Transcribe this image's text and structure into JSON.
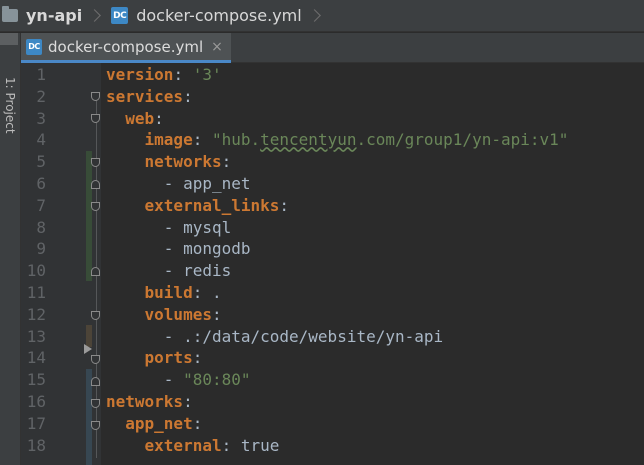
{
  "breadcrumb": {
    "project": "yn-api",
    "file": "docker-compose.yml",
    "file_icon": "DC"
  },
  "toolstrip": {
    "label": "1: Project"
  },
  "tab": {
    "label": "docker-compose.yml",
    "close": "×",
    "icon": "DC"
  },
  "editor": {
    "lines": [
      {
        "n": "1",
        "key": "version",
        "sep": ": ",
        "value": "'3'",
        "vtype": "str"
      },
      {
        "n": "2",
        "key": "services",
        "sep": ":",
        "value": "",
        "vtype": ""
      },
      {
        "n": "3",
        "indent": "  ",
        "key": "web",
        "sep": ":",
        "value": "",
        "vtype": ""
      },
      {
        "n": "4",
        "indent": "    ",
        "key": "image",
        "sep": ": ",
        "value": "\"hub.tencentyun.com/group1/yn-api:v1\"",
        "vtype": "str"
      },
      {
        "n": "5",
        "indent": "    ",
        "key": "networks",
        "sep": ":",
        "value": "",
        "vtype": ""
      },
      {
        "n": "6",
        "indent": "      ",
        "key": "",
        "sep": "",
        "value": "- app_net",
        "vtype": "plain"
      },
      {
        "n": "7",
        "indent": "    ",
        "key": "external_links",
        "sep": ":",
        "value": "",
        "vtype": ""
      },
      {
        "n": "8",
        "indent": "      ",
        "key": "",
        "sep": "",
        "value": "- mysql",
        "vtype": "plain"
      },
      {
        "n": "9",
        "indent": "      ",
        "key": "",
        "sep": "",
        "value": "- mongodb",
        "vtype": "plain"
      },
      {
        "n": "10",
        "indent": "      ",
        "key": "",
        "sep": "",
        "value": "- redis",
        "vtype": "plain"
      },
      {
        "n": "11",
        "indent": "    ",
        "key": "build",
        "sep": ": ",
        "value": ".",
        "vtype": "plain"
      },
      {
        "n": "12",
        "indent": "    ",
        "key": "volumes",
        "sep": ":",
        "value": "",
        "vtype": ""
      },
      {
        "n": "13",
        "indent": "      ",
        "key": "",
        "sep": "",
        "value": "- .:/data/code/website/yn-api",
        "vtype": "plain"
      },
      {
        "n": "14",
        "indent": "    ",
        "key": "ports",
        "sep": ":",
        "value": "",
        "vtype": ""
      },
      {
        "n": "15",
        "indent": "      ",
        "key": "",
        "sep": "",
        "value": "- \"80:80\"",
        "vtype": "mixed"
      },
      {
        "n": "16",
        "key": "networks",
        "sep": ":",
        "value": "",
        "vtype": ""
      },
      {
        "n": "17",
        "indent": "  ",
        "key": "app_net",
        "sep": ":",
        "value": "",
        "vtype": ""
      },
      {
        "n": "18",
        "indent": "    ",
        "key": "external",
        "sep": ": ",
        "value": "true",
        "vtype": "plain"
      }
    ]
  },
  "colors": {
    "key": "#cc7832",
    "string": "#6a8759",
    "text": "#a9b7c6",
    "line_number": "#606366",
    "vcs_added": "#384c38",
    "vcs_modified": "#374752",
    "tab_underline": "#4a88c7"
  },
  "icons": [
    "folder-icon",
    "chevron-right-icon",
    "docker-compose-icon",
    "close-icon",
    "fold-icon"
  ]
}
